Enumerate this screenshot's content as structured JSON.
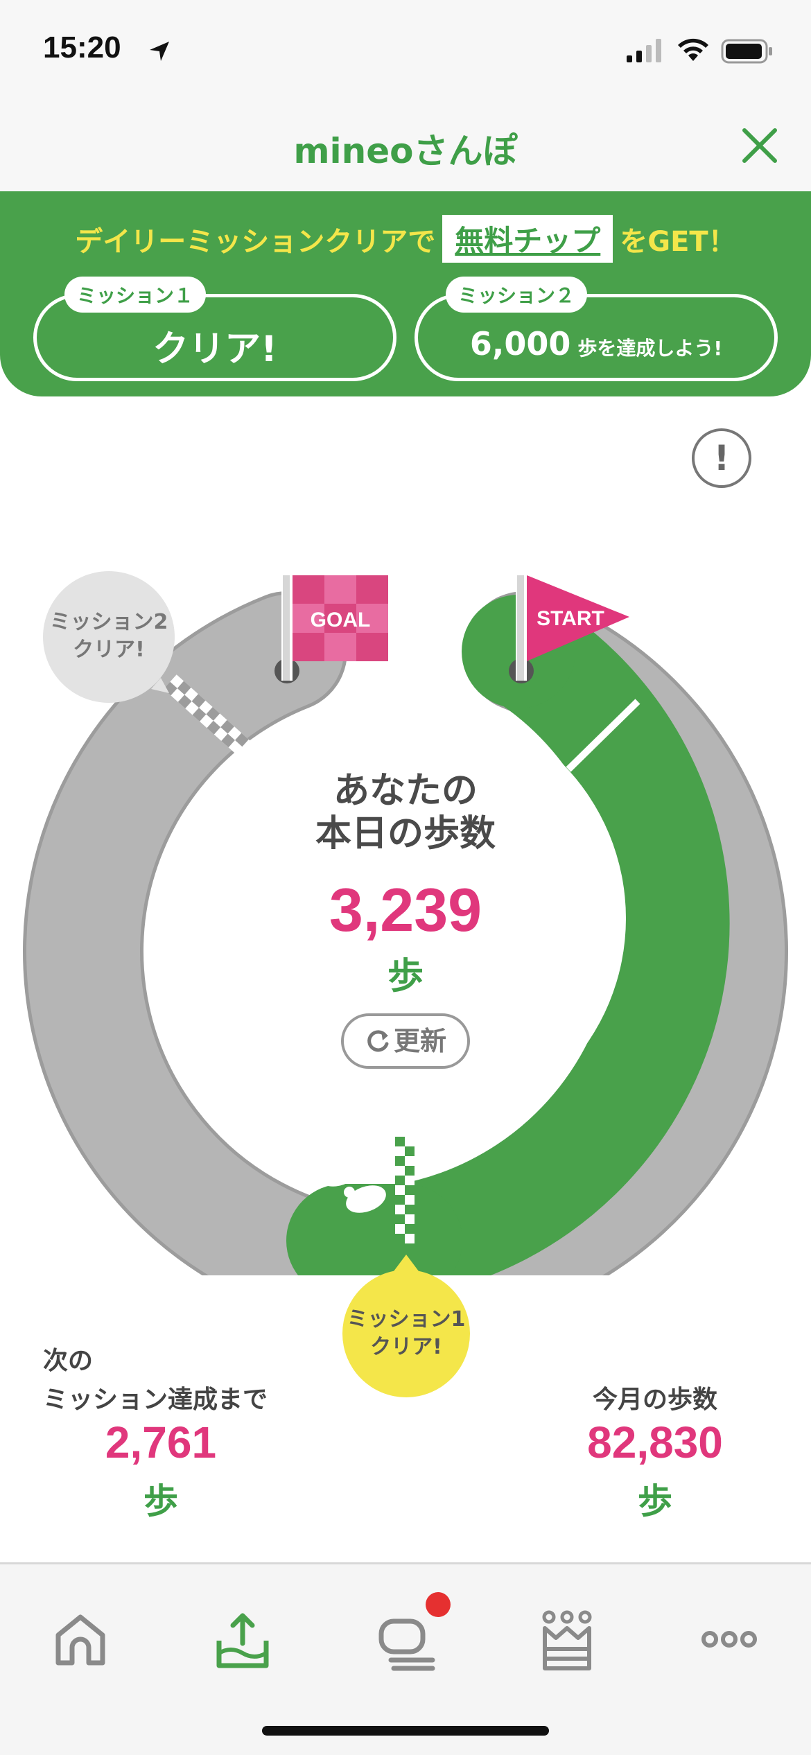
{
  "status_bar": {
    "time": "15:20"
  },
  "header": {
    "title": "mineoさんぽ"
  },
  "banner": {
    "text_before": "デイリーミッションクリアで",
    "highlight": "無料チップ",
    "text_after": "をGET！",
    "mission1": {
      "tag": "ミッション１",
      "status": "クリア!"
    },
    "mission2": {
      "tag": "ミッション２",
      "goal_number": "6,000",
      "goal_text": "歩を達成しよう!"
    }
  },
  "info_button": "!",
  "ring": {
    "goal_flag": "GOAL",
    "start_flag": "START",
    "mission2_bubble": [
      "ミッション2",
      "クリア!"
    ],
    "mission1_bubble": [
      "ミッション1",
      "クリア!"
    ],
    "progress_fraction": 0.5
  },
  "center": {
    "label_line1": "あなたの",
    "label_line2": "本日の歩数",
    "steps": "3,239",
    "unit": "歩",
    "refresh_label": "更新"
  },
  "stats": {
    "next_label_line1": "次の",
    "next_label_line2": "ミッション達成まで",
    "next_steps": "2,761",
    "next_unit": "歩",
    "month_label": "今月の歩数",
    "month_steps": "82,830",
    "month_unit": "歩"
  },
  "tab_bar": {
    "icons": [
      "home-icon",
      "walk-upload-icon",
      "chat-icon",
      "crown-icon",
      "more-icon"
    ],
    "active_index": 1
  },
  "colors": {
    "green": "#49a14b",
    "pink": "#e0377c",
    "yellow": "#f4e64a",
    "gray_track": "#b5b5b5"
  }
}
